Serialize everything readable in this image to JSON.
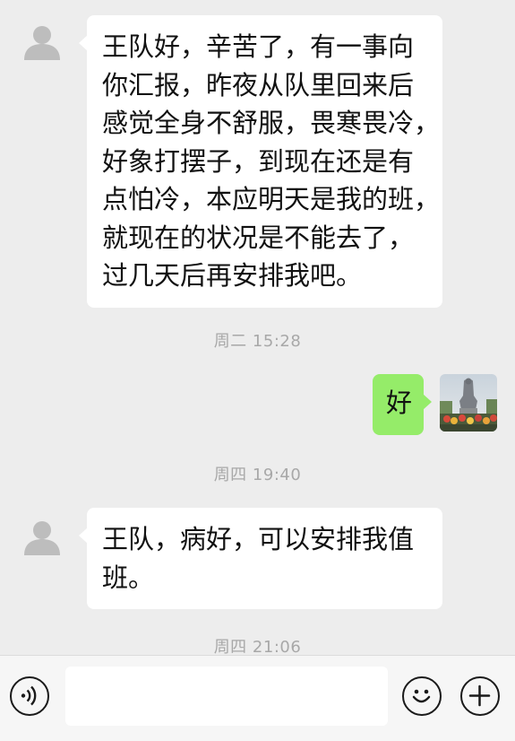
{
  "messages": [
    {
      "side": "left",
      "lines": [
        "王队好，辛苦了，有一事向",
        "你汇报，昨夜从队里回来后",
        "感觉全身不舒服，畏寒畏冷，",
        "好象打摆子，到现在还是有",
        "点怕冷，本应明天是我的班，",
        "就现在的状况是不能去了，",
        "过几天后再安排我吧。"
      ]
    },
    {
      "type": "timestamp",
      "text": "周二 15:28"
    },
    {
      "side": "right",
      "text": "好"
    },
    {
      "type": "timestamp",
      "text": "周四 19:40"
    },
    {
      "side": "left",
      "lines": [
        "王队，病好，可以安排我值",
        "班。"
      ]
    },
    {
      "type": "timestamp",
      "text": "周四 21:06"
    }
  ],
  "toolbar": {
    "voice_icon": "voice-icon",
    "emoji_icon": "emoji-icon",
    "plus_icon": "plus-icon",
    "input_value": ""
  },
  "colors": {
    "background": "#ededed",
    "incoming_bubble": "#ffffff",
    "outgoing_bubble": "#95ec69",
    "timestamp_text": "#a8a8a8"
  }
}
